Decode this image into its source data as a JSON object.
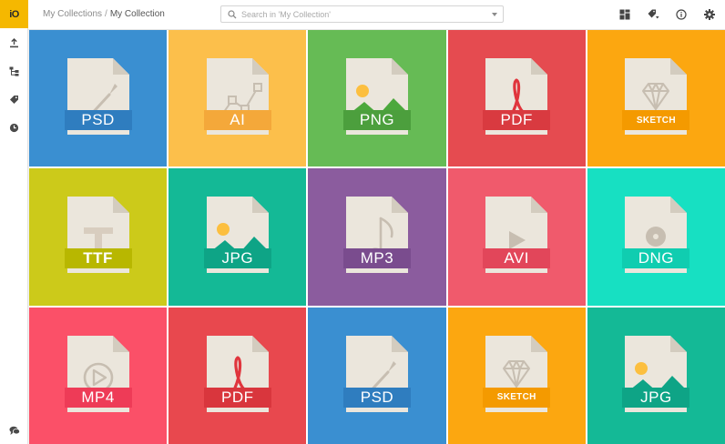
{
  "sidebar": {
    "logo_text": "iO",
    "items": [
      {
        "name": "upload",
        "icon": "upload-icon"
      },
      {
        "name": "hierarchy",
        "icon": "hierarchy-icon"
      },
      {
        "name": "tags",
        "icon": "tag-icon"
      },
      {
        "name": "recent",
        "icon": "clock-icon"
      }
    ],
    "bottom_icon": "chat-icon"
  },
  "header": {
    "breadcrumb": [
      "My Collections",
      "My Collection"
    ],
    "breadcrumb_separator": "/",
    "search": {
      "placeholder": "Search in 'My Collection'",
      "value": ""
    },
    "toolbar": [
      {
        "name": "layout",
        "icon": "grid-layout-icon"
      },
      {
        "name": "filter",
        "icon": "tag-filter-icon"
      },
      {
        "name": "info",
        "icon": "info-icon"
      },
      {
        "name": "settings",
        "icon": "gear-icon"
      }
    ]
  },
  "tiles": [
    {
      "label": "PSD",
      "icon": "brush-icon",
      "bg": "#3a8fd1",
      "badge": "#2f7dbf"
    },
    {
      "label": "AI",
      "icon": "vector-path-icon",
      "bg": "#fcbf4b",
      "badge": "#f4a83a"
    },
    {
      "label": "PNG",
      "icon": "image-icon",
      "bg": "#66bb55",
      "badge": "#4c9f3d"
    },
    {
      "label": "PDF",
      "icon": "acrobat-icon",
      "bg": "#e54b50",
      "badge": "#d93a40"
    },
    {
      "label": "SKETCH",
      "icon": "diamond-icon",
      "bg": "#fca710",
      "badge": "#f49a00",
      "small": true
    },
    {
      "label": "TTF",
      "icon": "font-icon",
      "bg": "#ccca1a",
      "badge": "#b8b700",
      "bold": true
    },
    {
      "label": "JPG",
      "icon": "image-icon",
      "bg": "#14b996",
      "badge": "#0ea486"
    },
    {
      "label": "MP3",
      "icon": "music-note-icon",
      "bg": "#8b5c9e",
      "badge": "#7a4c8e"
    },
    {
      "label": "AVI",
      "icon": "play-icon",
      "bg": "#f05a6c",
      "badge": "#e2465a"
    },
    {
      "label": "DNG",
      "icon": "disc-icon",
      "bg": "#17e0c2",
      "badge": "#10cdb0"
    },
    {
      "label": "MP4",
      "icon": "play-circle-icon",
      "bg": "#fb5068",
      "badge": "#ee3b57"
    },
    {
      "label": "PDF",
      "icon": "acrobat-icon",
      "bg": "#e8484e",
      "badge": "#d9363d"
    },
    {
      "label": "PSD",
      "icon": "brush-icon",
      "bg": "#3a8fd1",
      "badge": "#2f7dbf"
    },
    {
      "label": "SKETCH",
      "icon": "diamond-icon",
      "bg": "#fca710",
      "badge": "#f49a00",
      "small": true
    },
    {
      "label": "JPG",
      "icon": "image-icon",
      "bg": "#14b996",
      "badge": "#0ea486"
    }
  ]
}
